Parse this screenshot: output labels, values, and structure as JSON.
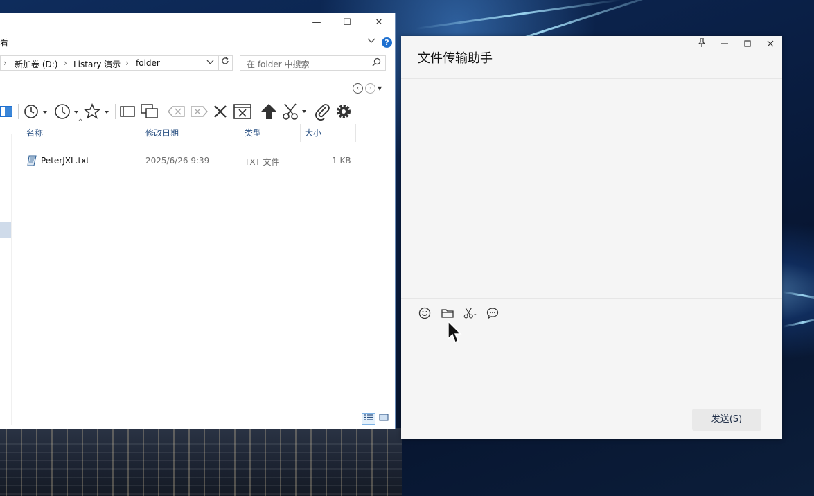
{
  "explorer": {
    "menu_fragment": "看",
    "window_controls": [
      "—",
      "☐",
      "✕"
    ],
    "address": {
      "separator": "›",
      "segments": [
        "新加卷 (D:)",
        "Listary 演示",
        "folder"
      ],
      "refresh_icon": "refresh-icon"
    },
    "search": {
      "placeholder": "在 folder 中搜索"
    },
    "columns": [
      "名称",
      "修改日期",
      "类型",
      "大小"
    ],
    "files": [
      {
        "name": "PeterJXL.txt",
        "modified": "2025/6/26 9:39",
        "type": "TXT 文件",
        "size": "1 KB"
      }
    ],
    "toolbar_icons": [
      "pane-icon",
      "history-icon",
      "recent-icon",
      "favorite-star-icon",
      "panel-icon",
      "new-window-icon",
      "backspace-icon",
      "forward-delete-icon",
      "close-x-icon",
      "close-window-icon",
      "up-arrow-icon",
      "cut-icon",
      "attach-icon",
      "gear-icon"
    ],
    "accent": "#1e70d0"
  },
  "chat": {
    "title": "文件传输助手",
    "window_controls": [
      "pin-icon",
      "minimize-icon",
      "maximize-icon",
      "close-icon"
    ],
    "tools": [
      "emoji-icon",
      "folder-icon",
      "scissors-icon",
      "chat-bubble-icon"
    ],
    "send_label": "发送(S)"
  }
}
